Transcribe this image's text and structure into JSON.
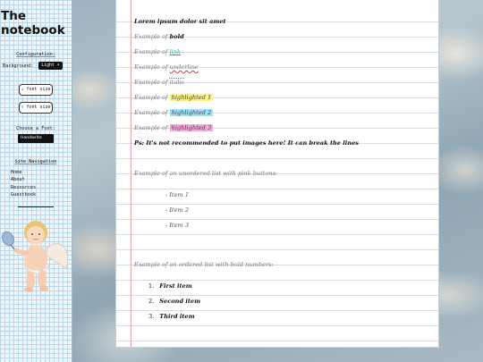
{
  "site": {
    "title": "The notebook"
  },
  "config": {
    "heading": "Configuration:",
    "background_label": "Background:",
    "background_toggle": "Light ☀",
    "increase_font": "↓ font size",
    "decrease_font": "↑ font size",
    "choose_font_label": "Choose a Font:",
    "font_value": "Handwrite"
  },
  "navigation": {
    "heading": "Site Navigation",
    "items": [
      "Home",
      "About",
      "Resources",
      "Guestbook"
    ]
  },
  "content": {
    "intro": "Lorem ipsum dolor sit amet",
    "example_prefix": "Example of",
    "examples": {
      "bold": "bold",
      "link": "link",
      "underline": "underline",
      "italic": "italic",
      "h1": "highlighted 1",
      "h2": "highlighted 2",
      "h3": "highlighted 3"
    },
    "note": "Ps: It's not recommended to put images here! It can break the lines",
    "unordered_heading": "Example of an unordered list with pink buttons:",
    "unordered_items": [
      "Item 1",
      "Item 2",
      "Item 3"
    ],
    "ordered_heading": "Example of an ordered list with bold numbers:",
    "ordered_items": [
      "First item",
      "Second item",
      "Third item"
    ],
    "ordered_numbers": [
      "1.",
      "2.",
      "3."
    ]
  },
  "colors": {
    "margin_line": "#e7a1a8",
    "highlight_1": "#fff37a",
    "highlight_2": "#9fe2f5",
    "highlight_3": "#f7a6d8"
  },
  "icons": {
    "cherub": "cherub-illustration",
    "list_bullet": "dash-bullet"
  }
}
